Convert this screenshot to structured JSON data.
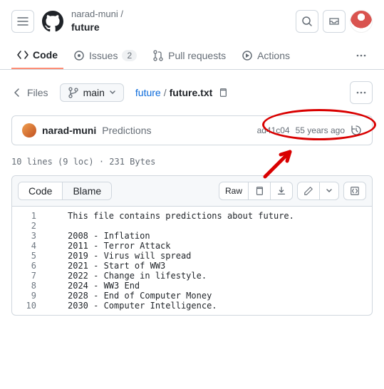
{
  "header": {
    "owner": "narad-muni /",
    "repo": "future"
  },
  "nav": {
    "code": "Code",
    "issues": "Issues",
    "issues_count": "2",
    "pulls": "Pull requests",
    "actions": "Actions"
  },
  "filebar": {
    "files": "Files",
    "branch": "main",
    "crumb_root": "future",
    "crumb_sep": "/",
    "crumb_file": "future.txt"
  },
  "commit": {
    "author": "narad-muni",
    "message": "Predictions",
    "sha": "ad41c04",
    "time": "55 years ago"
  },
  "fileinfo": "10 lines (9 loc) · 231 Bytes",
  "tabs": {
    "code": "Code",
    "blame": "Blame",
    "raw": "Raw"
  },
  "lines": [
    "This file contains predictions about future.",
    "",
    "2008 - Inflation",
    "2011 - Terror Attack",
    "2019 - Virus will spread",
    "2021 - Start of WW3",
    "2022 - Change in lifestyle.",
    "2024 - WW3 End",
    "2028 - End of Computer Money",
    "2030 - Computer Intelligence."
  ]
}
